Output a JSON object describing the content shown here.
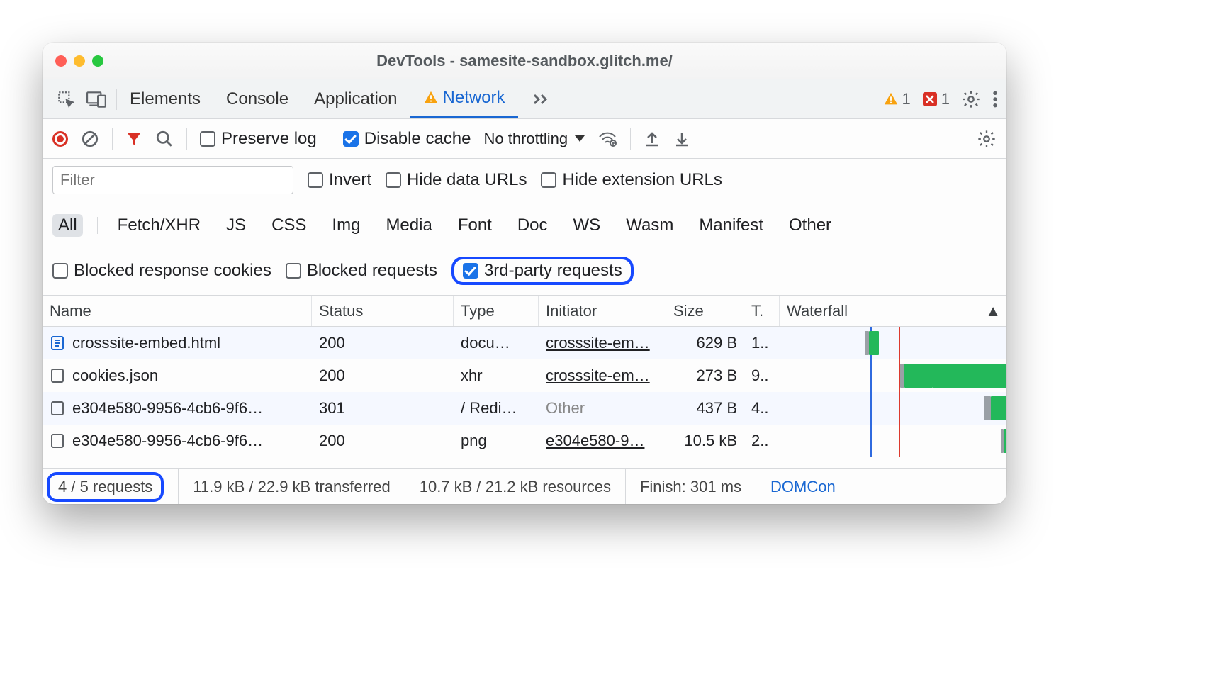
{
  "window": {
    "title": "DevTools - samesite-sandbox.glitch.me/"
  },
  "tabs": [
    "Elements",
    "Console",
    "Application",
    "Network"
  ],
  "active_tab": "Network",
  "counts": {
    "warnings": "1",
    "errors": "1"
  },
  "toolbar": {
    "preserve_log": "Preserve log",
    "disable_cache": "Disable cache",
    "throttling": "No throttling"
  },
  "filters": {
    "placeholder": "Filter",
    "invert": "Invert",
    "hide_data": "Hide data URLs",
    "hide_ext": "Hide extension URLs",
    "types": [
      "All",
      "Fetch/XHR",
      "JS",
      "CSS",
      "Img",
      "Media",
      "Font",
      "Doc",
      "WS",
      "Wasm",
      "Manifest",
      "Other"
    ],
    "active_type": "All",
    "blocked_cookies": "Blocked response cookies",
    "blocked_requests": "Blocked requests",
    "third_party": "3rd-party requests"
  },
  "grid": {
    "headers": [
      "Name",
      "Status",
      "Type",
      "Initiator",
      "Size",
      "T.",
      "Waterfall"
    ],
    "rows": [
      {
        "icon": "doc-blue",
        "name": "crosssite-embed.html",
        "status": "200",
        "type": "docu…",
        "initiator": "crosssite-em…",
        "initiator_kind": "link",
        "size": "629 B",
        "time": "1..",
        "wf": {
          "start": 120,
          "w1": 6,
          "w2": 14,
          "tail": 0
        }
      },
      {
        "icon": "doc-outline",
        "name": "cookies.json",
        "status": "200",
        "type": "xhr",
        "initiator": "crosssite-em…",
        "initiator_kind": "link",
        "size": "273 B",
        "time": "9..",
        "wf": {
          "start": 170,
          "w1": 6,
          "w2": 40,
          "tail": 1
        }
      },
      {
        "icon": "doc-outline",
        "name": "e304e580-9956-4cb6-9f6…",
        "status": "301",
        "type": "/ Redi…",
        "initiator": "Other",
        "initiator_kind": "other",
        "size": "437 B",
        "time": "4..",
        "wf": {
          "start": 288,
          "w1": 10,
          "w2": 28,
          "tail": 1
        }
      },
      {
        "icon": "doc-outline",
        "name": "e304e580-9956-4cb6-9f6…",
        "status": "200",
        "type": "png",
        "initiator": "e304e580-9…",
        "initiator_kind": "link",
        "size": "10.5 kB",
        "time": "2..",
        "wf": {
          "start": 312,
          "w1": 4,
          "w2": 18,
          "tail": 1
        }
      }
    ]
  },
  "status": {
    "requests": "4 / 5 requests",
    "transferred": "11.9 kB / 22.9 kB transferred",
    "resources": "10.7 kB / 21.2 kB resources",
    "finish": "Finish: 301 ms",
    "domcontent": "DOMCon"
  }
}
